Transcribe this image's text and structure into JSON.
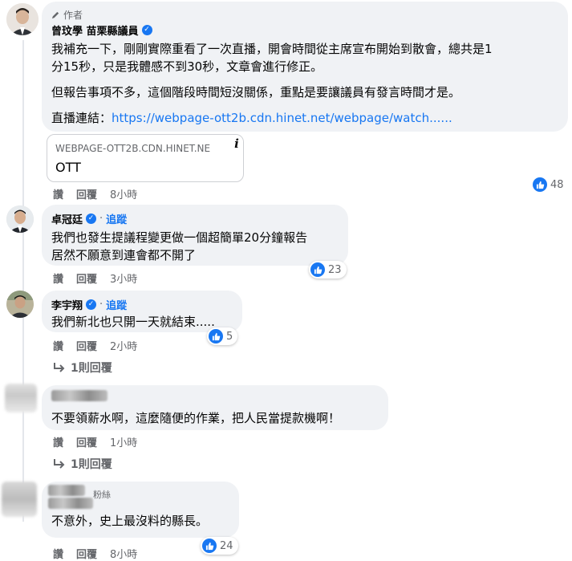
{
  "colors": {
    "link": "#1877f2",
    "bubble": "#f0f2f5",
    "meta": "#65676b"
  },
  "comment1": {
    "author_badge": "作者",
    "name": "曾玟學 苗栗縣議員",
    "lines": [
      "我補充一下，剛剛實際重看了一次直播，開會時間從主席宣布開始到散會，總共是1",
      "分15秒，只是我體感不到30秒，文章會進行修正。"
    ],
    "para2": "但報告事項不多，這個階段時間短沒關係，重點是要讓議員有發言時間才是。",
    "live_label": "直播連結：",
    "live_url": "https://webpage-ott2b.cdn.hinet.net/webpage/watch......",
    "card_domain": "WEBPAGE-OTT2B.CDN.HINET.NE",
    "card_title": "OTT",
    "card_info_icon": "i",
    "like": "讚",
    "reply": "回覆",
    "time": "8小時",
    "reactions": "48"
  },
  "comment2": {
    "name": "卓冠廷",
    "dot": "·",
    "follow": "追蹤",
    "lines": [
      "我們也發生提議程變更做一個超簡單20分鐘報告",
      "居然不願意到連會都不開了"
    ],
    "like": "讚",
    "reply": "回覆",
    "time": "3小時",
    "reactions": "23"
  },
  "comment3": {
    "name": "李宇翔",
    "dot": "·",
    "follow": "追蹤",
    "lines": [
      "我們新北也只開一天就結束....."
    ],
    "like": "讚",
    "reply": "回覆",
    "time": "2小時",
    "reactions": "5",
    "replies_link": "1則回覆"
  },
  "comment4": {
    "lines": [
      "不要領薪水啊，這麼隨便的作業，把人民當提款機啊！"
    ],
    "like": "讚",
    "reply": "回覆",
    "time": "1小時",
    "replies_link": "1則回覆"
  },
  "comment5": {
    "badge": "粉絲",
    "lines": [
      "不意外，史上最沒料的縣長。"
    ],
    "like": "讚",
    "reply": "回覆",
    "time": "8小時",
    "reactions": "24"
  }
}
